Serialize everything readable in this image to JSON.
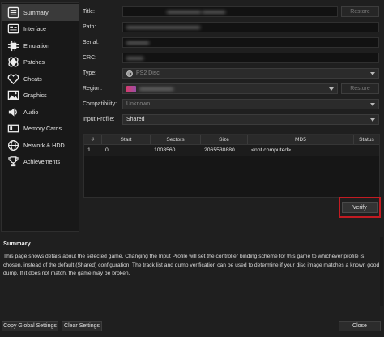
{
  "sidebar": {
    "items": [
      {
        "label": "Summary",
        "icon": "list-icon"
      },
      {
        "label": "Interface",
        "icon": "interface-icon"
      },
      {
        "label": "Emulation",
        "icon": "chip-icon"
      },
      {
        "label": "Patches",
        "icon": "bandage-icon"
      },
      {
        "label": "Cheats",
        "icon": "heart-icon"
      },
      {
        "label": "Graphics",
        "icon": "image-icon"
      },
      {
        "label": "Audio",
        "icon": "speaker-icon"
      },
      {
        "label": "Memory Cards",
        "icon": "memory-card-icon"
      },
      {
        "label": "Network & HDD",
        "icon": "globe-icon"
      },
      {
        "label": "Achievements",
        "icon": "trophy-icon"
      }
    ]
  },
  "form": {
    "title_label": "Title:",
    "path_label": "Path:",
    "serial_label": "Serial:",
    "crc_label": "CRC:",
    "type_label": "Type:",
    "type_value": "PS2 Disc",
    "region_label": "Region:",
    "compat_label": "Compatibility:",
    "compat_value": "Unknown",
    "input_profile_label": "Input Profile:",
    "input_profile_value": "Shared",
    "restore_label": "Restore"
  },
  "table": {
    "headers": [
      "#",
      "Start",
      "Sectors",
      "Size",
      "MD5",
      "Status"
    ],
    "rows": [
      [
        "1",
        "0",
        "1008560",
        "2065530880",
        "<not computed>",
        ""
      ]
    ]
  },
  "verify_label": "Verify",
  "summary": {
    "title": "Summary",
    "text": "This page shows details about the selected game. Changing the Input Profile will set the controller binding scheme for this game to whichever profile is chosen, instead of the default (Shared) configuration. The track list and dump verification can be used to determine if your disc image matches a known good dump. If it does not match, the game may be broken."
  },
  "buttons": {
    "copy_global": "Copy Global Settings",
    "clear": "Clear Settings",
    "close": "Close"
  },
  "colors": {
    "highlight_box": "#c21b22",
    "active_item": "#3a3a3a"
  }
}
